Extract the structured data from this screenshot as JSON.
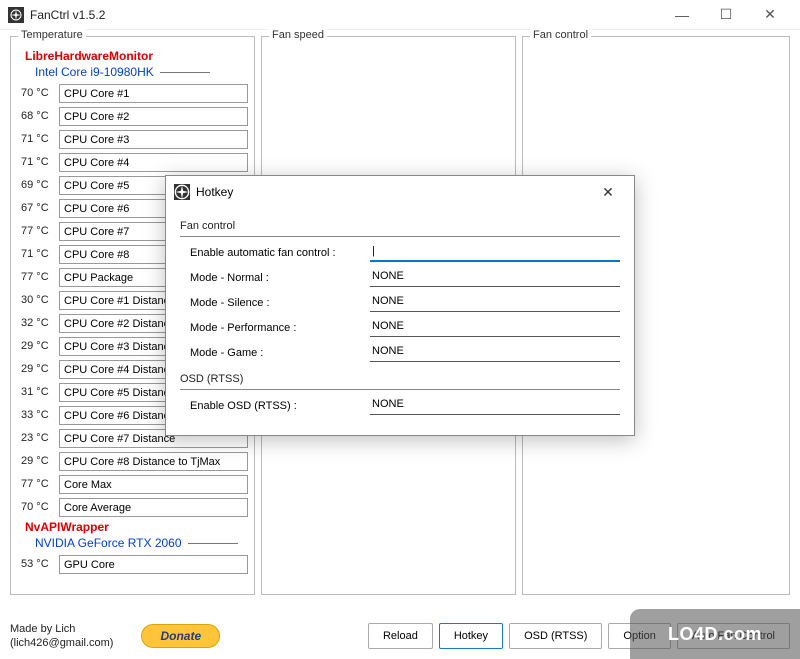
{
  "window": {
    "title": "FanCtrl v1.5.2"
  },
  "panels": {
    "temperature": "Temperature",
    "fanspeed": "Fan speed",
    "fancontrol": "Fan control"
  },
  "sources": [
    {
      "name": "LibreHardwareMonitor",
      "device": "Intel Core i9-10980HK",
      "rows": [
        {
          "temp": "70 °C",
          "label": "CPU Core #1"
        },
        {
          "temp": "68 °C",
          "label": "CPU Core #2"
        },
        {
          "temp": "71 °C",
          "label": "CPU Core #3"
        },
        {
          "temp": "71 °C",
          "label": "CPU Core #4"
        },
        {
          "temp": "69 °C",
          "label": "CPU Core #5"
        },
        {
          "temp": "67 °C",
          "label": "CPU Core #6"
        },
        {
          "temp": "77 °C",
          "label": "CPU Core #7"
        },
        {
          "temp": "71 °C",
          "label": "CPU Core #8"
        },
        {
          "temp": "77 °C",
          "label": "CPU Package"
        },
        {
          "temp": "30 °C",
          "label": "CPU Core #1 Distance"
        },
        {
          "temp": "32 °C",
          "label": "CPU Core #2 Distance"
        },
        {
          "temp": "29 °C",
          "label": "CPU Core #3 Distance"
        },
        {
          "temp": "29 °C",
          "label": "CPU Core #4 Distance"
        },
        {
          "temp": "31 °C",
          "label": "CPU Core #5 Distance"
        },
        {
          "temp": "33 °C",
          "label": "CPU Core #6 Distance"
        },
        {
          "temp": "23 °C",
          "label": "CPU Core #7 Distance"
        },
        {
          "temp": "29 °C",
          "label": "CPU Core #8 Distance to TjMax"
        },
        {
          "temp": "77 °C",
          "label": "Core Max"
        },
        {
          "temp": "70 °C",
          "label": "Core Average"
        }
      ]
    },
    {
      "name": "NvAPIWrapper",
      "device": "NVIDIA GeForce RTX 2060",
      "rows": [
        {
          "temp": "53 °C",
          "label": "GPU Core"
        }
      ]
    }
  ],
  "footer": {
    "credit_l1": "Made by Lich",
    "credit_l2": "(lich426@gmail.com)",
    "donate": "Donate",
    "reload": "Reload",
    "hotkey": "Hotkey",
    "osd": "OSD (RTSS)",
    "option": "Option",
    "auto": "Auto Fan Control"
  },
  "dialog": {
    "title": "Hotkey",
    "section_fan": "Fan control",
    "rows_fan": [
      {
        "label": "Enable automatic fan control :",
        "value": ""
      },
      {
        "label": "Mode - Normal :",
        "value": "NONE"
      },
      {
        "label": "Mode - Silence :",
        "value": "NONE"
      },
      {
        "label": "Mode - Performance :",
        "value": "NONE"
      },
      {
        "label": "Mode - Game :",
        "value": "NONE"
      }
    ],
    "section_osd": "OSD (RTSS)",
    "rows_osd": [
      {
        "label": "Enable OSD (RTSS) :",
        "value": "NONE"
      }
    ]
  },
  "watermark": "LO4D.com"
}
